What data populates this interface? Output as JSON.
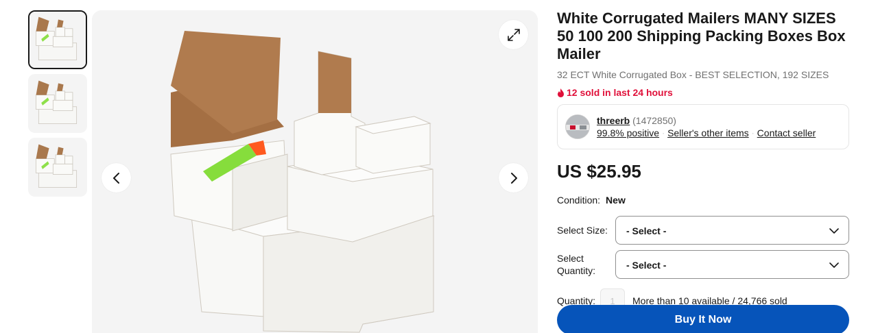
{
  "gallery": {
    "thumbnails": [
      {
        "icon": "product-thumbnail-1",
        "selected": true
      },
      {
        "icon": "product-thumbnail-2",
        "selected": false
      },
      {
        "icon": "product-thumbnail-3",
        "selected": false
      }
    ],
    "expand_icon": "expand-icon",
    "prev_icon": "chevron-left-icon",
    "next_icon": "chevron-right-icon"
  },
  "listing": {
    "title": "White Corrugated Mailers MANY SIZES 50 100 200 Shipping Packing Boxes Box Mailer",
    "subtitle": "32 ECT White Corrugated Box - BEST SELECTION, 192 SIZES",
    "urgency": "12 sold in last 24 hours",
    "urgency_color": "#e0103a"
  },
  "seller": {
    "name": "threerb",
    "feedback_count": "(1472850)",
    "positive": "99.8% positive",
    "other_items": "Seller's other items",
    "contact": "Contact seller"
  },
  "price": "US $25.95",
  "condition": {
    "label": "Condition:",
    "value": "New"
  },
  "options": {
    "size_label": "Select Size:",
    "size_value": "- Select -",
    "quantity_select_label": "Select Quantity:",
    "quantity_select_value": "- Select -"
  },
  "quantity": {
    "label": "Quantity:",
    "value": "1",
    "availability": "More than 10 available / 24,766 sold"
  },
  "buy_button": {
    "label": "Buy It Now",
    "color": "#0654ba"
  }
}
